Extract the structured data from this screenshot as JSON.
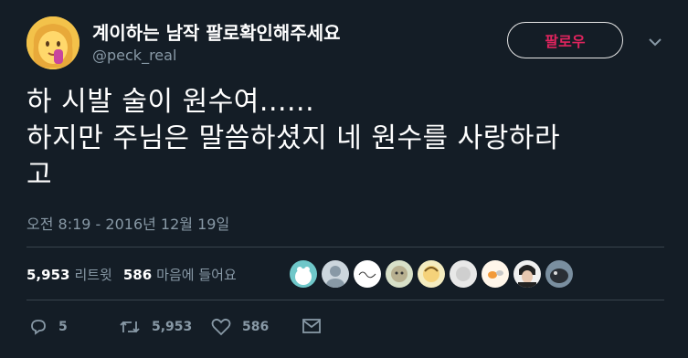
{
  "user": {
    "display_name": "계이하는 남작 팔로확인해주세요",
    "handle": "@peck_real",
    "avatar_icon": "emoji-face-avatar"
  },
  "follow_button": {
    "label": "팔로우"
  },
  "tweet": {
    "lines": [
      "하 시발 술이 원수여......",
      "하지만 주님은 말씀하셨지 네 원수를 사랑하라",
      "고"
    ],
    "timestamp": "오전 8:19 - 2016년 12월 19일"
  },
  "stats": {
    "retweets_count": "5,953",
    "retweets_label": "리트윗",
    "likes_count": "586",
    "likes_label": "마음에 들어요"
  },
  "likers_count_shown": 9,
  "actions": {
    "reply_count": "5",
    "retweet_count": "5,953",
    "like_count": "586"
  },
  "colors": {
    "background": "#141d26",
    "secondary_text": "#8899a6",
    "follow_accent": "#e0245e",
    "divider": "#38444d"
  }
}
